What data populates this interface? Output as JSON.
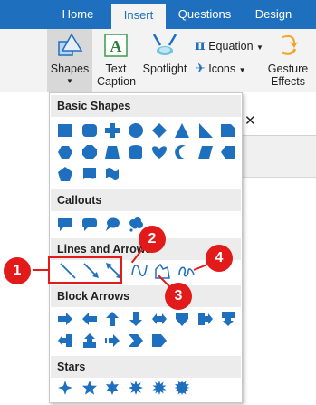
{
  "tabs": [
    {
      "label": "Home"
    },
    {
      "label": "Insert"
    },
    {
      "label": "Questions"
    },
    {
      "label": "Design"
    }
  ],
  "ribbon": {
    "shapes_label": "Shapes",
    "text_caption_label": "Text Caption",
    "spotlight_label": "Spotlight",
    "equation_label": "Equation",
    "icons_label": "Icons",
    "gesture_effects_label": "Gesture Effects"
  },
  "gallery": {
    "sections": [
      {
        "title": "Basic Shapes"
      },
      {
        "title": "Callouts"
      },
      {
        "title": "Lines and Arrows"
      },
      {
        "title": "Block Arrows"
      },
      {
        "title": "Stars"
      }
    ]
  },
  "callouts": {
    "c1": "1",
    "c2": "2",
    "c3": "3",
    "c4": "4"
  },
  "colors": {
    "accent": "#1f6fbf",
    "shape_fill": "#1f6fbf",
    "highlight": "#e21a1a"
  }
}
